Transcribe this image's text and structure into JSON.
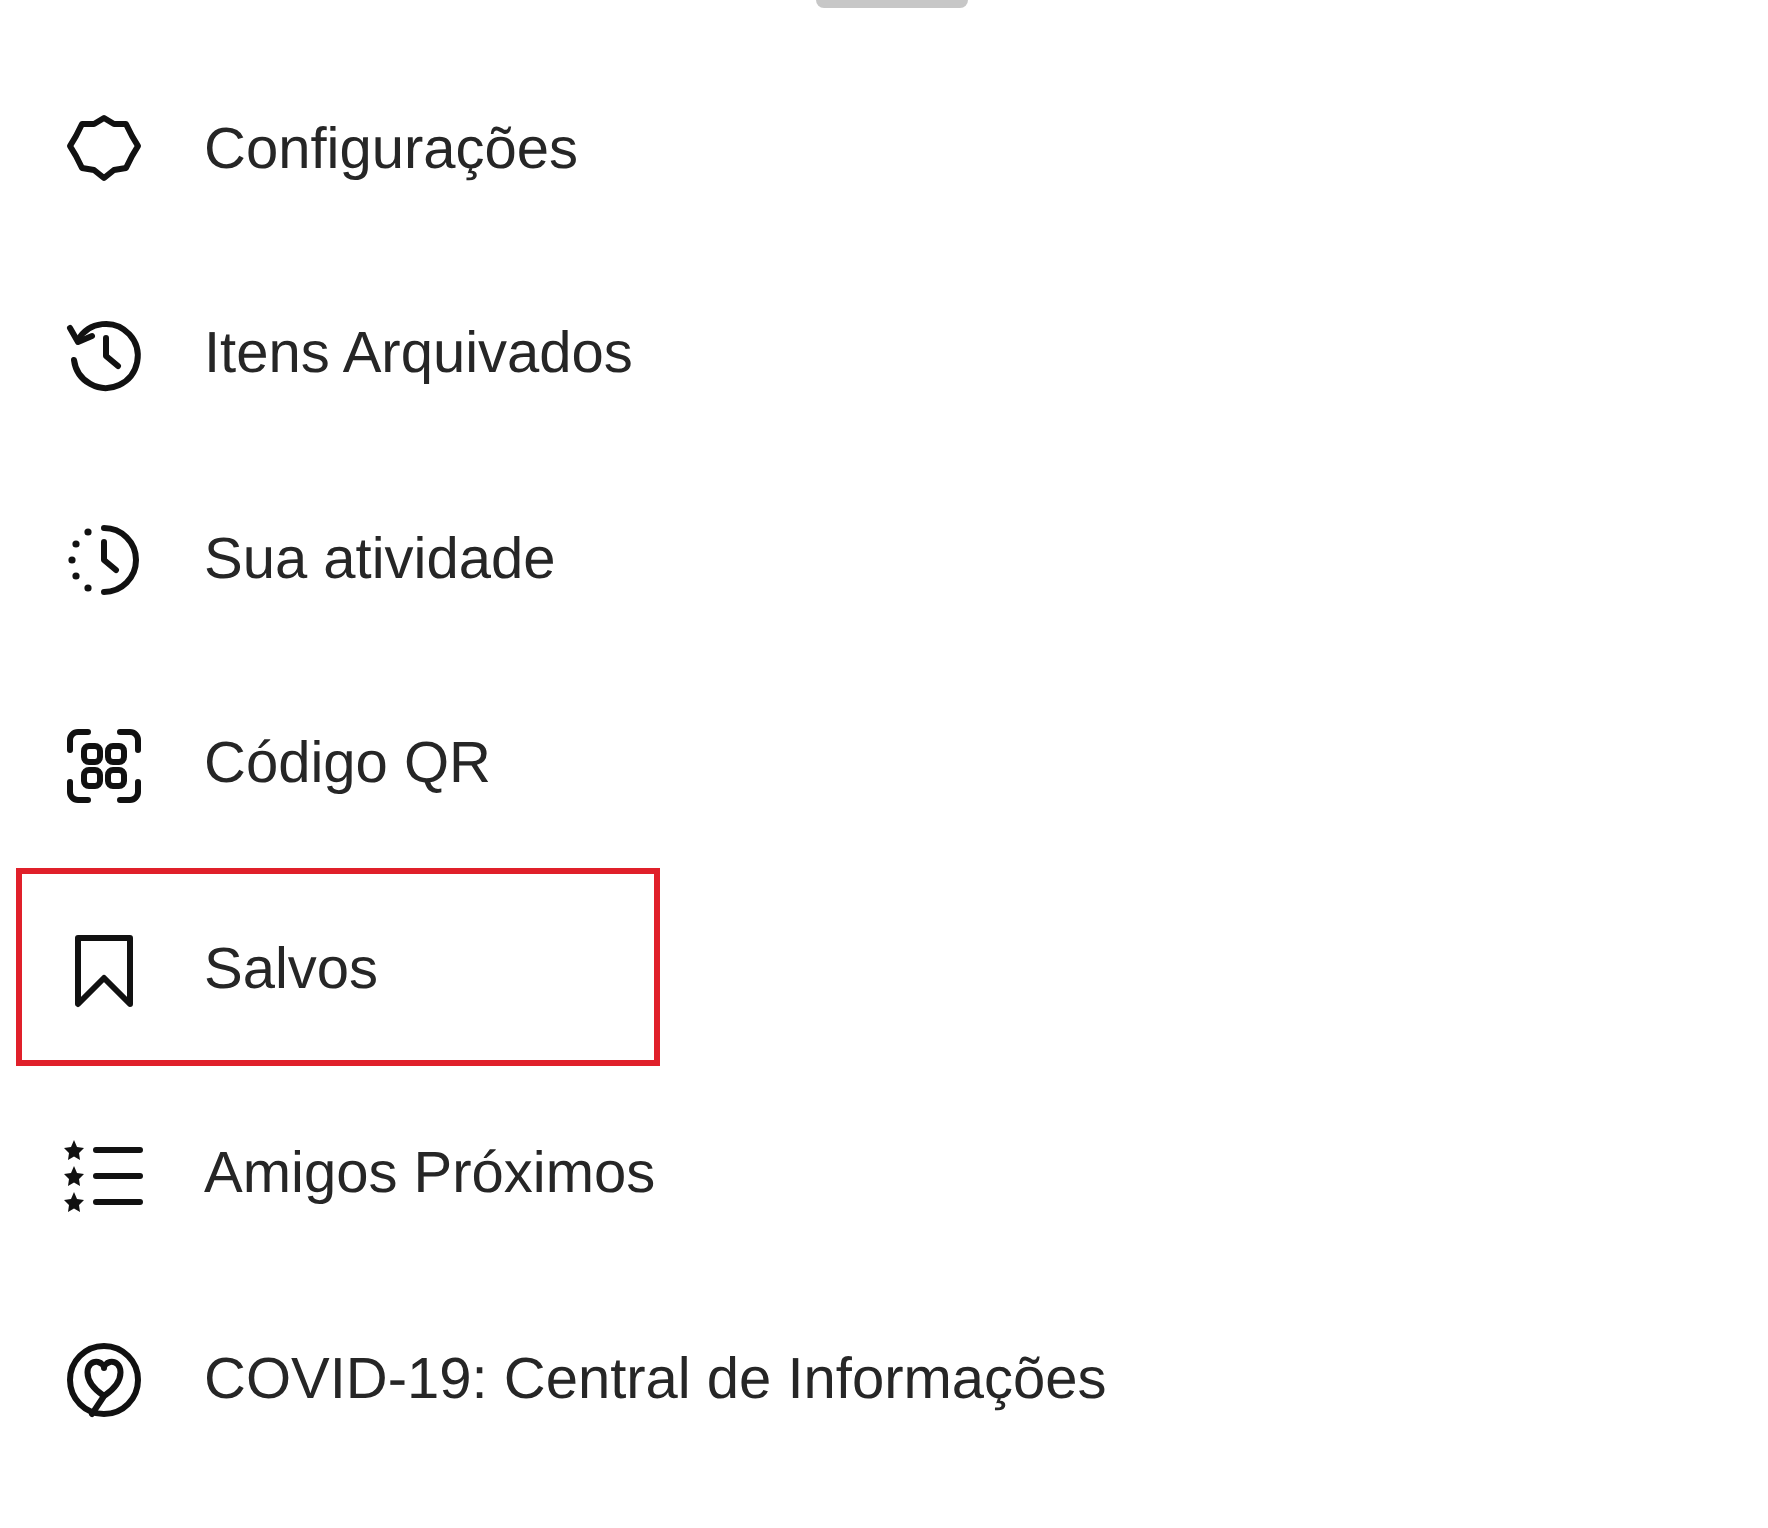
{
  "menu": {
    "items": [
      {
        "label": "Configurações",
        "highlighted": false
      },
      {
        "label": "Itens Arquivados",
        "highlighted": false
      },
      {
        "label": "Sua atividade",
        "highlighted": false
      },
      {
        "label": "Código QR",
        "highlighted": false
      },
      {
        "label": "Salvos",
        "highlighted": true
      },
      {
        "label": "Amigos Próximos",
        "highlighted": false
      },
      {
        "label": "COVID-19: Central de Informações",
        "highlighted": false
      }
    ]
  }
}
